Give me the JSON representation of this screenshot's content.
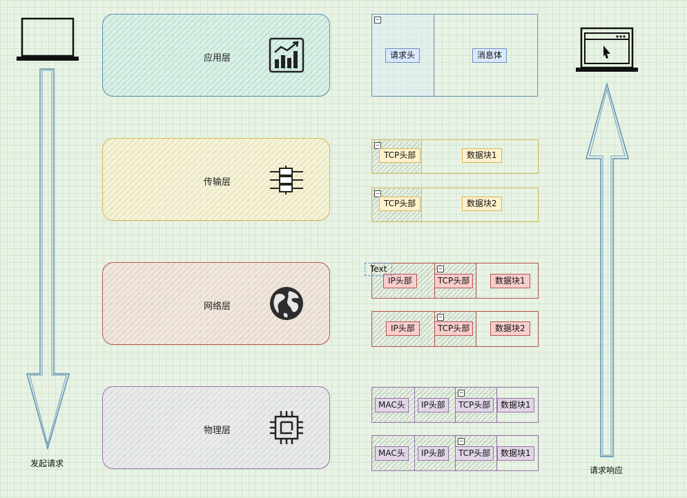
{
  "layers": [
    {
      "label": "应用层"
    },
    {
      "label": "传输层"
    },
    {
      "label": "网络层"
    },
    {
      "label": "物理层"
    }
  ],
  "app_packet": {
    "header": "请求头",
    "body": "消息体"
  },
  "tcp_packets": [
    {
      "header": "TCP头部",
      "data": "数据块1"
    },
    {
      "header": "TCP头部",
      "data": "数据块2"
    }
  ],
  "ip_packets": [
    {
      "ip": "IP头部",
      "tcp": "TCP头部",
      "data": "数据块1"
    },
    {
      "ip": "IP头部",
      "tcp": "TCP头部",
      "data": "数据块2"
    }
  ],
  "mac_packets": [
    {
      "mac": "MAC头",
      "ip": "IP头部",
      "tcp": "TCP头部",
      "data": "数据块1"
    },
    {
      "mac": "MAC头",
      "ip": "IP头部",
      "tcp": "TCP头部",
      "data": "数据块1"
    }
  ],
  "floating_text": "Text",
  "collapse_symbol": "−",
  "left_caption": "发起请求",
  "right_caption": "请求响应",
  "colors": {
    "application": "#5a8fb0",
    "transport": "#d6b656",
    "network": "#b85450",
    "physical": "#9673a6"
  }
}
